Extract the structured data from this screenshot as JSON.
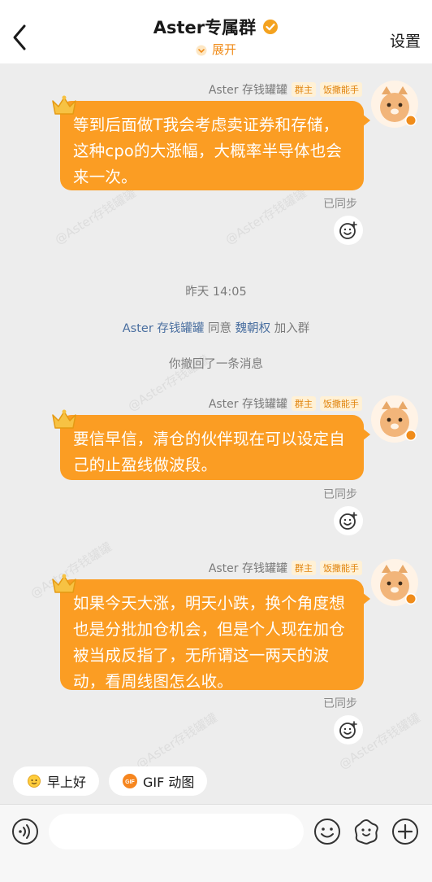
{
  "header": {
    "title": "Aster专属群",
    "expand_label": "展开",
    "settings_label": "设置"
  },
  "watermark": "@Aster存钱罐罐",
  "messages": [
    {
      "sender": "Aster 存钱罐罐",
      "tags": [
        "群主",
        "饭撒能手"
      ],
      "text": "等到后面做T我会考虑卖证券和存储，这种cpo的大涨幅，大概率半导体也会来一次。",
      "status": "已同步"
    },
    {
      "sender": "Aster 存钱罐罐",
      "tags": [
        "群主",
        "饭撒能手"
      ],
      "text": "要信早信，清仓的伙伴现在可以设定自己的止盈线做波段。",
      "status": "已同步"
    },
    {
      "sender": "Aster 存钱罐罐",
      "tags": [
        "群主",
        "饭撒能手"
      ],
      "text": "如果今天大涨，明天小跌，换个角度想也是分批加仓机会，但是个人现在加仓被当成反指了，无所谓这一两天的波动，看周线图怎么收。",
      "status": "已同步"
    }
  ],
  "system": {
    "time": "昨天 14:05",
    "join_actor": "Aster 存钱罐罐",
    "join_verb": "同意",
    "join_target": "魏朝权",
    "join_suffix": "加入群",
    "recall": "你撤回了一条消息"
  },
  "quick_replies": [
    {
      "label": "早上好",
      "icon": "sun-face-icon"
    },
    {
      "label": "GIF 动图",
      "icon": "gif-icon"
    }
  ],
  "colors": {
    "bubble": "#fb9d23",
    "accent": "#f08c1a",
    "link": "#4a6fa0"
  }
}
